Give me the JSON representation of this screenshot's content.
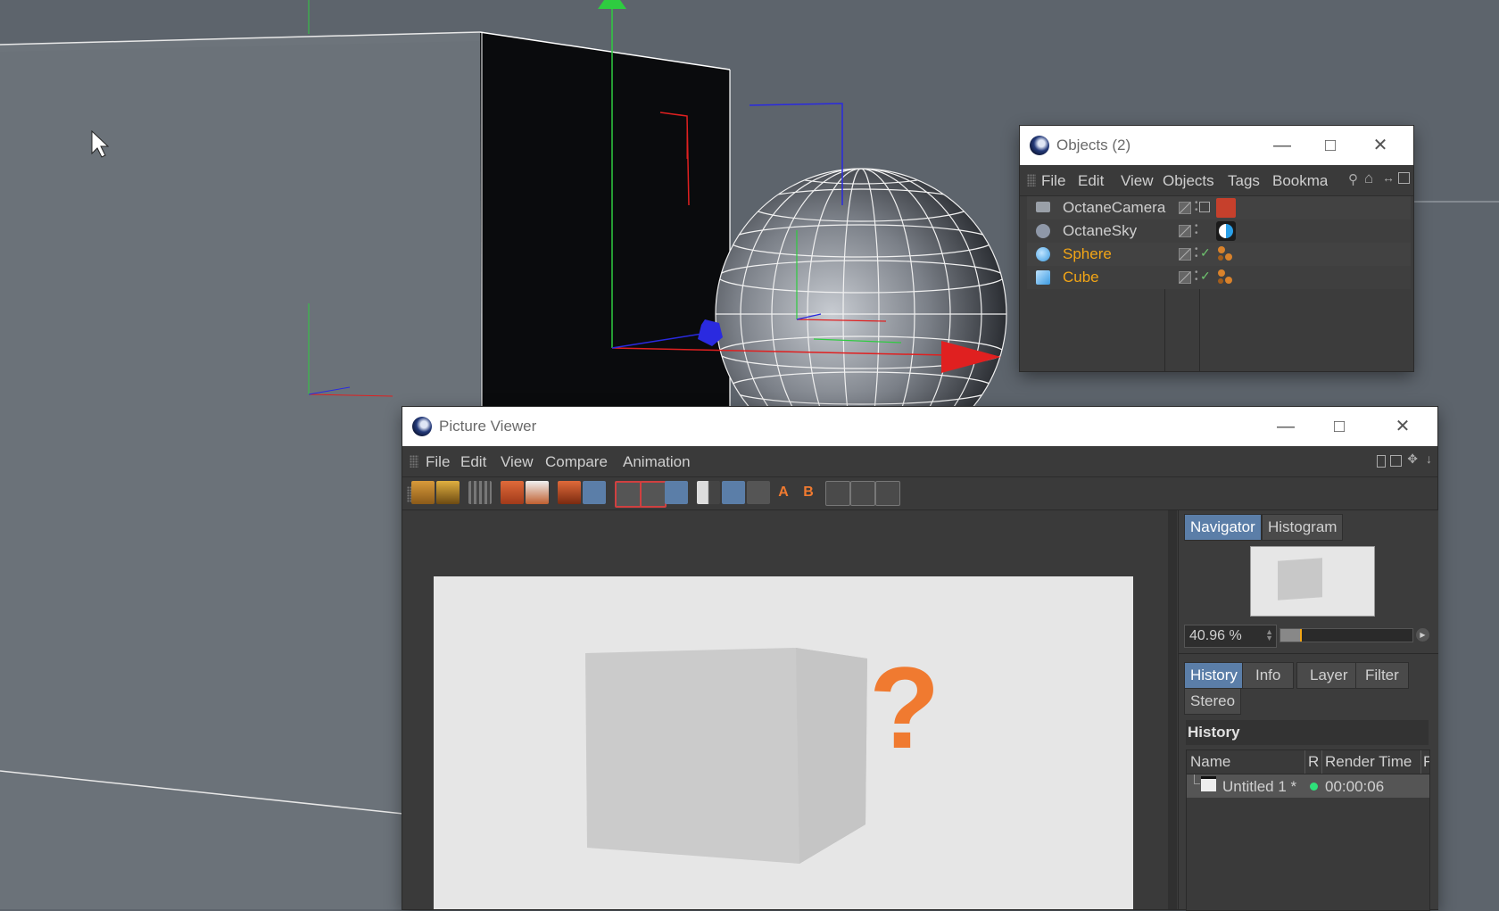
{
  "objects_window": {
    "title": "Objects (2)",
    "menu": [
      "File",
      "Edit",
      "View",
      "Objects",
      "Tags",
      "Bookma"
    ],
    "rows": [
      {
        "name": "OctaneCamera",
        "color": "#cfcfcf",
        "icon": "camera-icon"
      },
      {
        "name": "OctaneSky",
        "color": "#cfcfcf",
        "icon": "sky-icon"
      },
      {
        "name": "Sphere",
        "color": "#f2a516",
        "icon": "sphere-icon"
      },
      {
        "name": "Cube",
        "color": "#f2a516",
        "icon": "cube-icon"
      }
    ]
  },
  "picture_viewer": {
    "title": "Picture Viewer",
    "menu": [
      "File",
      "Edit",
      "View",
      "Compare",
      "Animation"
    ],
    "render": {
      "symbol": "?"
    },
    "navigator": {
      "tabs": [
        "Navigator",
        "Histogram"
      ],
      "zoom": "40.96 %"
    },
    "info_tabs": [
      "History",
      "Info",
      "Layer",
      "Filter",
      "Stereo"
    ],
    "history": {
      "section_title": "History",
      "columns": [
        "Name",
        "R",
        "Render Time",
        "F"
      ],
      "rows": [
        {
          "name": "Untitled 1 *",
          "time": "00:00:06"
        }
      ]
    }
  },
  "colors": {
    "viewport_bg": "#5d646c",
    "accent_tab": "#5b7ea8",
    "object_highlight": "#f2a516",
    "question_mark": "#f07a30"
  }
}
